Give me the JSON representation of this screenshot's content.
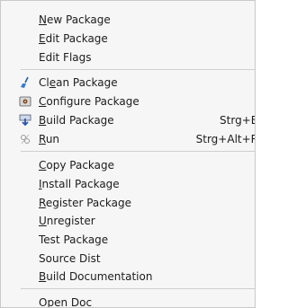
{
  "menu": {
    "items": [
      {
        "key": "new_package",
        "label": "New Package",
        "mnemonic": "N",
        "shortcut": ""
      },
      {
        "key": "edit_package",
        "label": "Edit Package",
        "mnemonic": "E",
        "shortcut": ""
      },
      {
        "key": "edit_flags",
        "label": "Edit Flags",
        "mnemonic": "",
        "shortcut": ""
      },
      {
        "key": "clean_package",
        "label": "Clean Package",
        "mnemonic": "e",
        "shortcut": "",
        "icon": "broom-icon"
      },
      {
        "key": "configure_package",
        "label": "Configure Package",
        "mnemonic": "C",
        "shortcut": "",
        "icon": "configure-icon"
      },
      {
        "key": "build_package",
        "label": "Build Package",
        "mnemonic": "B",
        "shortcut": "Strg+B",
        "icon": "build-icon"
      },
      {
        "key": "run",
        "label": "Run",
        "mnemonic": "R",
        "shortcut": "Strg+Alt+R",
        "icon": "run-icon"
      },
      {
        "key": "copy_package",
        "label": "Copy Package",
        "mnemonic": "C",
        "shortcut": ""
      },
      {
        "key": "install_package",
        "label": "Install Package",
        "mnemonic": "I",
        "shortcut": ""
      },
      {
        "key": "register_package",
        "label": "Register Package",
        "mnemonic": "R",
        "shortcut": ""
      },
      {
        "key": "unregister",
        "label": "Unregister",
        "mnemonic": "U",
        "shortcut": ""
      },
      {
        "key": "test_package",
        "label": "Test Package",
        "mnemonic": "",
        "shortcut": ""
      },
      {
        "key": "source_dist",
        "label": "Source Dist",
        "mnemonic": "",
        "shortcut": ""
      },
      {
        "key": "build_documentation",
        "label": "Build Documentation",
        "mnemonic": "B",
        "shortcut": ""
      },
      {
        "key": "open_doc",
        "label": "Open Doc",
        "mnemonic": "O",
        "shortcut": ""
      }
    ]
  }
}
